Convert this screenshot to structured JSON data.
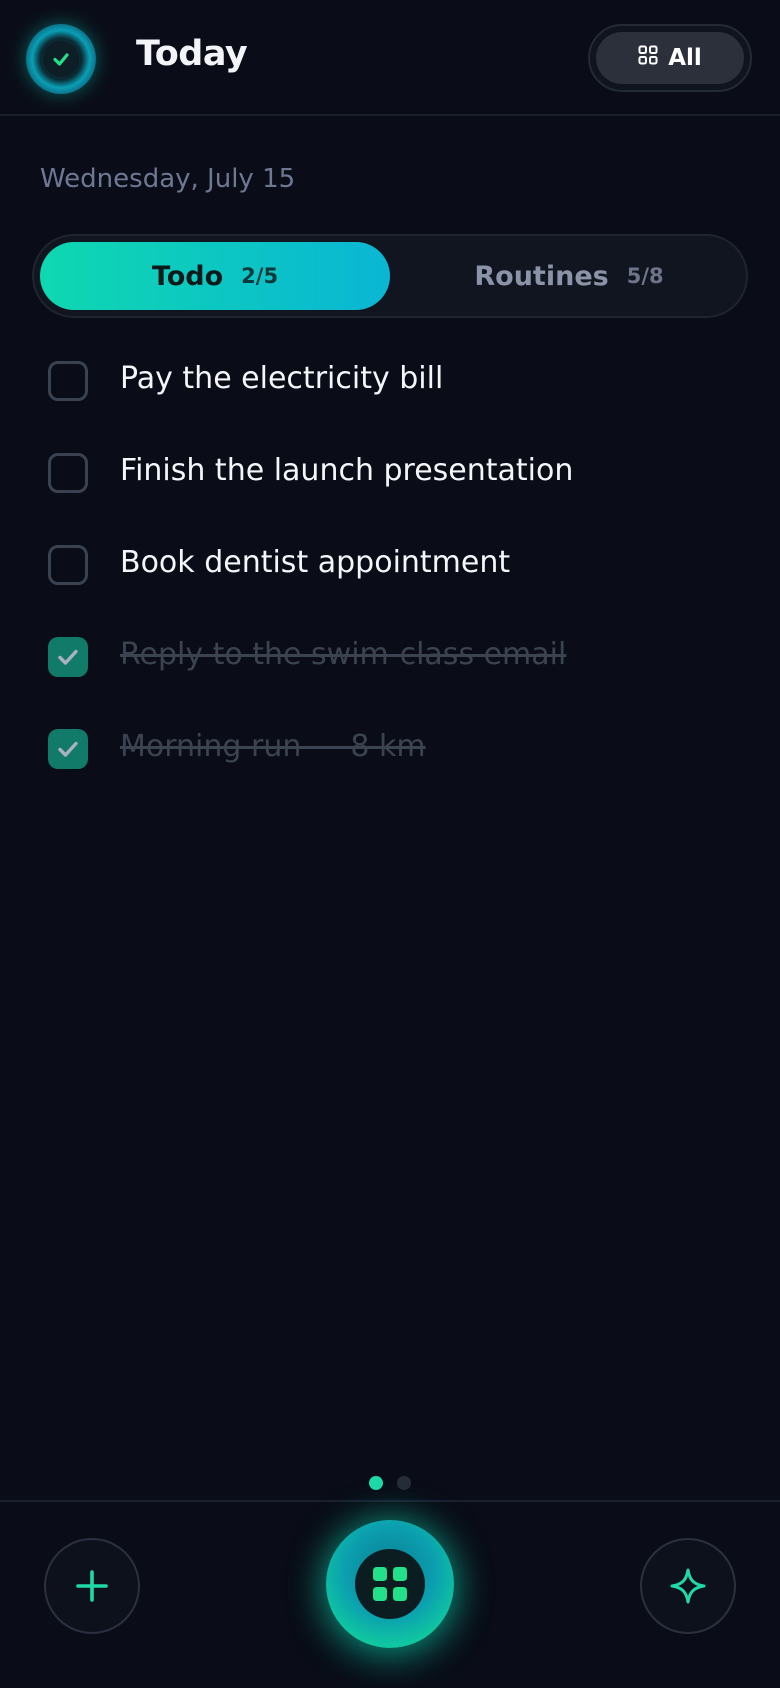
{
  "header": {
    "logo_icon": "check-circle-icon",
    "title": "Today",
    "filter_label": "All",
    "filter_icon": "grid-icon"
  },
  "date": "Wednesday, July 15",
  "tabs": [
    {
      "label": "Todo",
      "count": "2/5",
      "active": true
    },
    {
      "label": "Routines",
      "count": "5/8",
      "active": false
    }
  ],
  "tasks": [
    {
      "text": "Pay the electricity bill",
      "done": false
    },
    {
      "text": "Finish the launch presentation",
      "done": false
    },
    {
      "text": "Book dentist appointment",
      "done": false
    },
    {
      "text": "Reply to the swim-class email",
      "done": true
    },
    {
      "text": "Morning run — 8 km",
      "done": true
    }
  ],
  "pager": {
    "pages": 2,
    "current": 1
  },
  "bottom_bar": {
    "left_icon": "plus-icon",
    "center_icon": "apps-grid-icon",
    "right_icon": "sparkle-icon"
  },
  "colors": {
    "accent": "#1ed9a8",
    "accent_blue": "#0ab6d4",
    "background": "#0a0d17",
    "done_check": "#117a68"
  }
}
